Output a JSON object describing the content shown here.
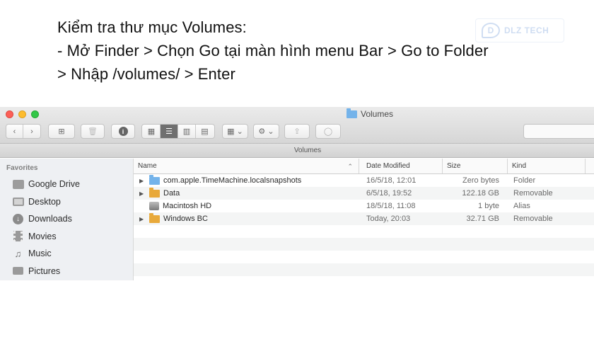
{
  "instructions": {
    "line1": "Kiểm tra thư mục Volumes:",
    "line2": "- Mở Finder > Chọn Go tại màn hình menu Bar > Go to Folder",
    "line3": "> Nhập /volumes/ > Enter"
  },
  "watermark": {
    "logo": "D",
    "text": "DLZ TECH"
  },
  "window": {
    "title": "Volumes",
    "path_label": "Volumes",
    "traffic_colors": [
      "#fc5f57",
      "#fdbc2e",
      "#33c748"
    ],
    "toolbar": {
      "back": "‹",
      "forward": "›",
      "new_folder": "⊞",
      "trash": "🗑",
      "info": "i",
      "views": [
        "▦",
        "☰",
        "▥",
        "▤"
      ],
      "arrange": "▦ ⌄",
      "action": "⚙ ⌄",
      "share": "⇪",
      "tag": "◯"
    }
  },
  "sidebar": {
    "heading": "Favorites",
    "items": [
      {
        "label": "Google Drive",
        "icon": "drive-icon"
      },
      {
        "label": "Desktop",
        "icon": "desktop-icon"
      },
      {
        "label": "Downloads",
        "icon": "downloads-icon"
      },
      {
        "label": "Movies",
        "icon": "movies-icon"
      },
      {
        "label": "Music",
        "icon": "music-icon"
      },
      {
        "label": "Pictures",
        "icon": "pictures-icon"
      }
    ]
  },
  "list": {
    "columns": {
      "name": "Name",
      "date": "Date Modified",
      "size": "Size",
      "kind": "Kind"
    },
    "rows": [
      {
        "name": "com.apple.TimeMachine.localsnapshots",
        "date": "16/5/18, 12:01",
        "size": "Zero bytes",
        "kind": "Folder"
      },
      {
        "name": "Data",
        "date": "6/5/18, 19:52",
        "size": "122.18 GB",
        "kind": "Removable"
      },
      {
        "name": "Macintosh HD",
        "date": "18/5/18, 11:08",
        "size": "1 byte",
        "kind": "Alias"
      },
      {
        "name": "Windows BC",
        "date": "Today, 20:03",
        "size": "32.71 GB",
        "kind": "Removable"
      }
    ]
  }
}
